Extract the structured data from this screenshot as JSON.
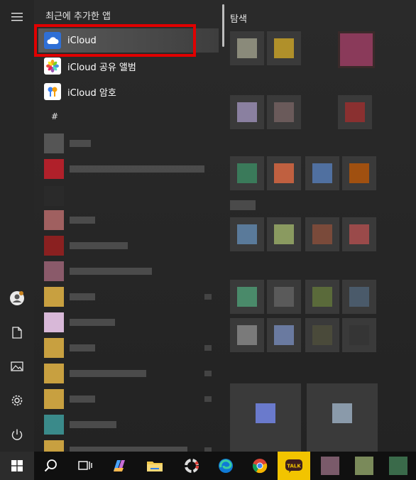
{
  "applist": {
    "recent_header": "최근에 추가한 앱",
    "recent_items": [
      {
        "label": "iCloud",
        "icon": "icloud-icon"
      },
      {
        "label": "iCloud 공유 앨범",
        "icon": "photos-icon"
      },
      {
        "label": "iCloud 암호",
        "icon": "key-icon"
      }
    ],
    "hash_header": "#"
  },
  "tiles": {
    "header": "탐색"
  },
  "colors": {
    "highlight_border": "#e00000",
    "background": "#262626",
    "taskbar": "#101010"
  }
}
